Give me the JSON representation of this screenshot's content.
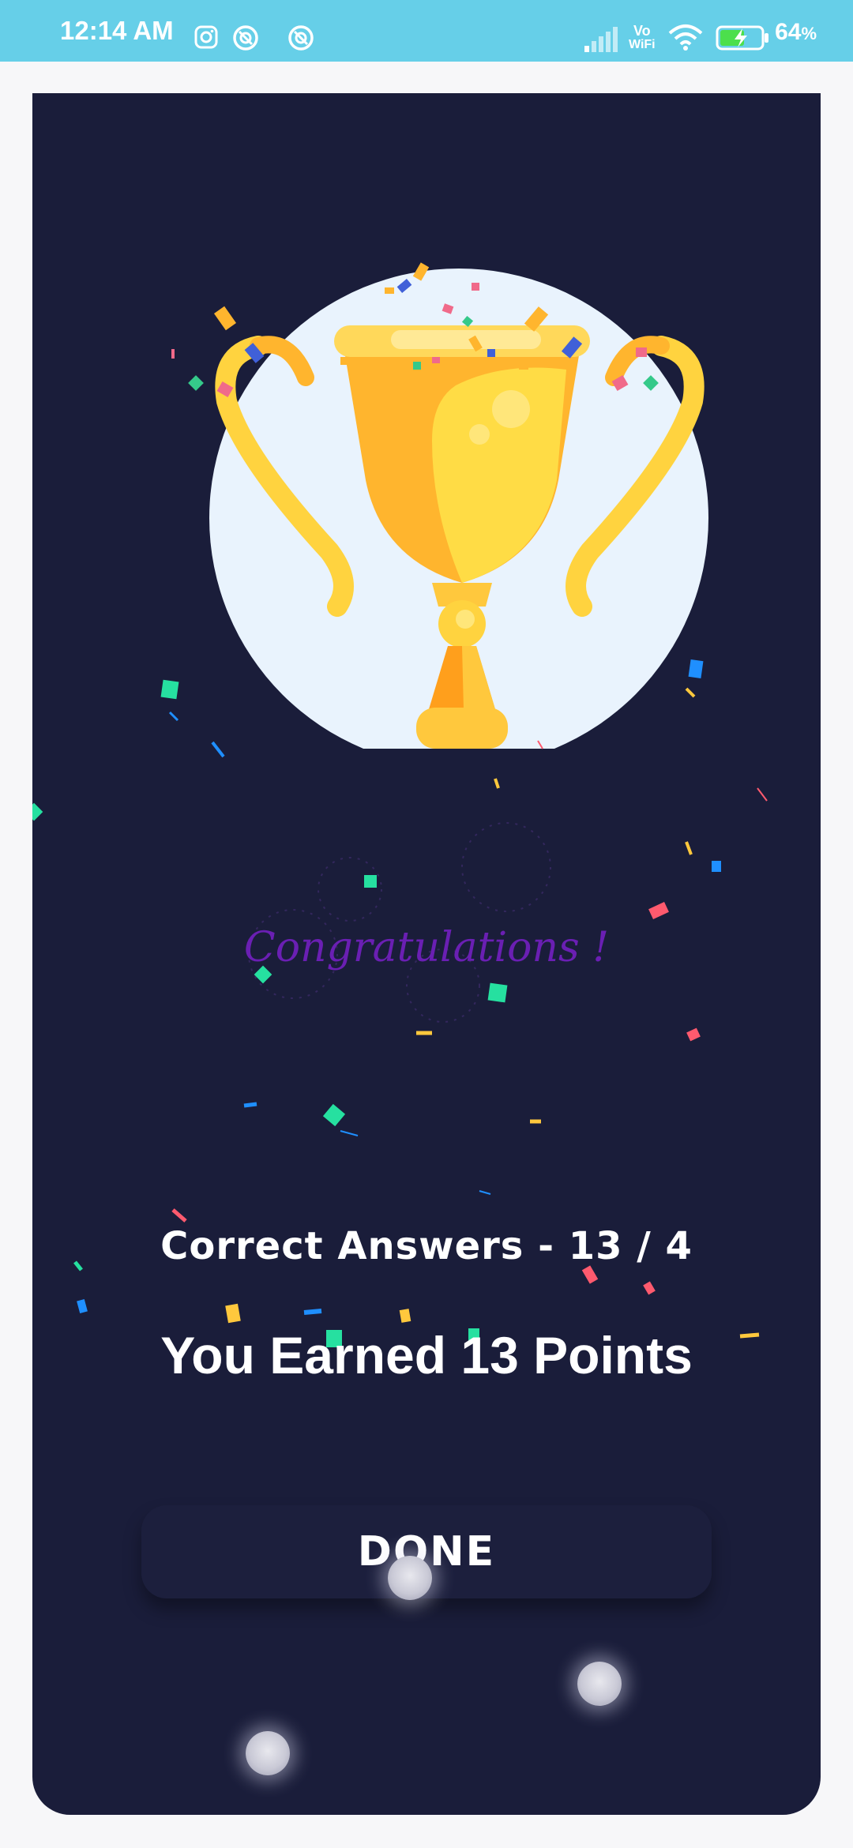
{
  "status_bar": {
    "time": "12:14 AM",
    "icons": [
      "instagram-icon",
      "app-notification-icon",
      "app-notification-icon",
      "signal-icon",
      "vowifi-icon",
      "wifi-icon",
      "battery-charging-icon"
    ],
    "vowifi_top": "Vo",
    "vowifi_bottom": "WiFi",
    "battery_percent": "64",
    "battery_unit": "%"
  },
  "result": {
    "congrats_text": "Congratulations !",
    "correct_answers": "Correct Answers - 13 / 4",
    "earned_text": "You Earned 13 Points",
    "done_label": "DONE"
  },
  "colors": {
    "status_bar": "#66cfe8",
    "card_background": "#1a1d3a",
    "congrats_text": "#6a1fb3",
    "trophy_gold": "#ffc83d",
    "trophy_circle": "#e9f3fd"
  }
}
